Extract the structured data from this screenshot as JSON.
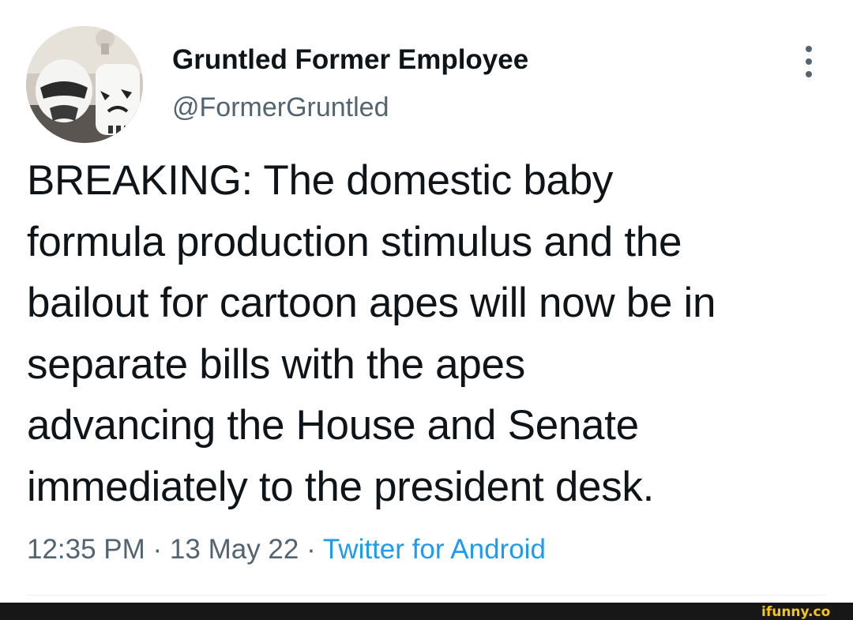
{
  "user": {
    "display_name": "Gruntled Former Employee",
    "handle": "@FormerGruntled"
  },
  "tweet": {
    "lines": [
      "BREAKING: The domestic baby",
      "formula production stimulus and the",
      "bailout for cartoon apes will now be in",
      "separate bills with the apes",
      "advancing the House and Senate",
      "immediately to the president desk."
    ]
  },
  "meta": {
    "time": "12:35 PM",
    "separator": " · ",
    "date": "13 May 22",
    "source": "Twitter for Android"
  },
  "icons": {
    "more": "more-vertical-icon",
    "avatar": "avatar-stormtrooper-photo",
    "watermark": "ifunny-logo"
  },
  "watermark": {
    "text": "ifunny.co"
  },
  "colors": {
    "text": "#0f1419",
    "secondary": "#536471",
    "link": "#1d9bf0",
    "footer": "#171717",
    "watermark": "#f5c518"
  }
}
